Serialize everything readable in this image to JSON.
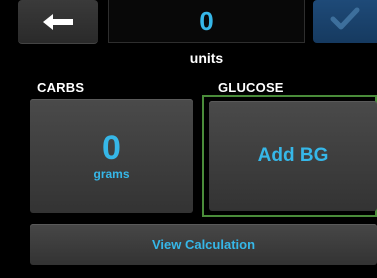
{
  "header": {
    "back_icon": "arrow-left-icon",
    "units_value": "0",
    "units_label": "units",
    "confirm_icon": "checkmark-icon"
  },
  "carbs": {
    "section_label": "CARBS",
    "value": "0",
    "unit": "grams"
  },
  "glucose": {
    "section_label": "GLUCOSE",
    "button_label": "Add BG"
  },
  "footer": {
    "view_calculation_label": "View Calculation"
  },
  "colors": {
    "accent": "#36b7e8",
    "focus_border": "#4a8c3a",
    "confirm_bg": "#1e4a78",
    "confirm_check": "#3d6f9c"
  }
}
